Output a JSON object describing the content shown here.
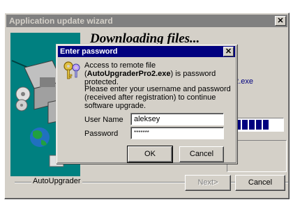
{
  "window": {
    "title": "Application update wizard",
    "close_glyph": "✕"
  },
  "wizard": {
    "heading": "Downloading files...",
    "file_fragment": "Pro2.exe",
    "progress_segments": 6,
    "group_label": "AutoUpgrader",
    "next_button": "Next>",
    "cancel_button": "Cancel"
  },
  "dialog": {
    "title": "Enter password",
    "close_glyph": "✕",
    "icon": "key-icon",
    "message_prefix": "Access to remote file (",
    "message_file": "AutoUpgraderPro2.exe",
    "message_suffix": ") is password protected.",
    "instructions": "Please enter your username and password (received after registration) to continue software upgrade.",
    "username_label": "User Name",
    "username_value": "aleksey",
    "password_label": "Password",
    "password_value": "*******",
    "ok_button": "OK",
    "cancel_button": "Cancel"
  },
  "colors": {
    "dialog_titlebar": "#00007f",
    "inactive_titlebar": "#808080",
    "face": "#d4d0c8",
    "illustration": "#008080"
  }
}
